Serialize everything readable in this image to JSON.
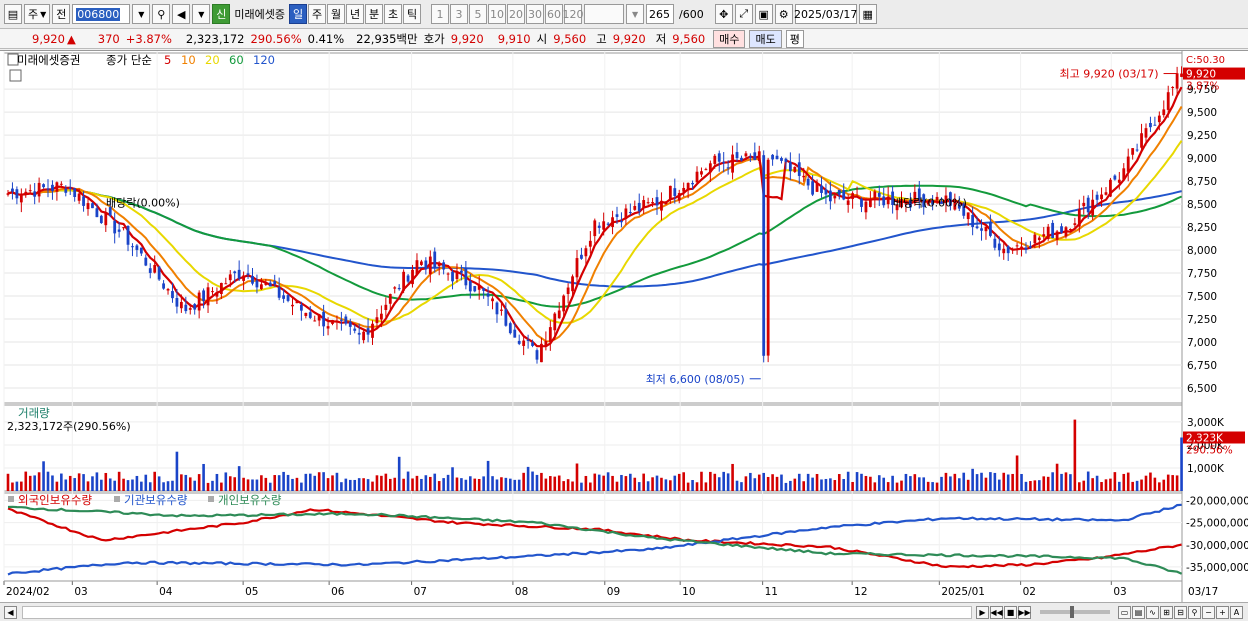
{
  "toolbar": {
    "period_main": "주",
    "prev": "전",
    "stock_code": "006800",
    "market_badge": "신",
    "stock_name": "미래에셋증",
    "periods": [
      "일",
      "주",
      "월",
      "년",
      "분",
      "초",
      "틱"
    ],
    "active_period": "일",
    "intervals": [
      "1",
      "3",
      "5",
      "10",
      "20",
      "30",
      "60",
      "120"
    ],
    "count": "265",
    "count_max": "/600",
    "date": "2025/03/17"
  },
  "quote": {
    "price": "9,920",
    "arrow": "▲",
    "change": "370",
    "change_pct": "+3.87%",
    "volume": "2,323,172",
    "volume_pct": "290.56%",
    "turnover": "0.41%",
    "amount": "22,935백만",
    "hoga_label": "호가",
    "ask": "9,920",
    "bid": "9,910",
    "open_label": "시",
    "open": "9,560",
    "high_label": "고",
    "high": "9,920",
    "low_label": "저",
    "low": "9,560",
    "buy": "매수",
    "sell": "매도",
    "avg": "평"
  },
  "price_panel": {
    "name": "미래에셋증권",
    "ma_label": "종가 단순",
    "ma_periods": [
      {
        "label": "5",
        "color": "#d40000"
      },
      {
        "label": "10",
        "color": "#f08000"
      },
      {
        "label": "20",
        "color": "#e8d800"
      },
      {
        "label": "60",
        "color": "#139a3c"
      },
      {
        "label": "120",
        "color": "#2255cc"
      }
    ],
    "corner_label": "C:50.30",
    "y_ticks": [
      "9,750",
      "9,500",
      "9,250",
      "9,000",
      "8,750",
      "8,500",
      "8,250",
      "8,000",
      "7,750",
      "7,500",
      "7,250",
      "7,000",
      "6,750",
      "6,500"
    ],
    "last_price_tag": "9,920",
    "last_pct_tag": "3.87%",
    "max_label": "최고 9,920 (03/17)",
    "min_label": "최저 6,600 (08/05)",
    "dividend_label_1": "배당락(0.00%)",
    "dividend_label_2": "배당락(0.00%)"
  },
  "volume_panel": {
    "title": "거래량",
    "value": "2,323,172주(290.56%)",
    "y_ticks": [
      "3,000K",
      "2,000K",
      "1,000K"
    ],
    "last_tag": "2,323K",
    "last_pct": "290.56%"
  },
  "holding_panel": {
    "series": [
      {
        "name": "외국인보유수량",
        "color": "#d40000"
      },
      {
        "name": "기관보유수량",
        "color": "#2255cc"
      },
      {
        "name": "개인보유수량",
        "color": "#2e8b57"
      }
    ],
    "y_ticks": [
      "-20,000,000",
      "-25,000,000",
      "-30,000,000",
      "-35,000,000"
    ]
  },
  "x_axis": {
    "labels": [
      "2024/02",
      "03",
      "04",
      "05",
      "06",
      "07",
      "08",
      "09",
      "10",
      "11",
      "12",
      "2025/01",
      "02",
      "03",
      "03/17"
    ]
  },
  "chart_data": {
    "type": "candlestick",
    "y_range": [
      6380,
      10100
    ],
    "min_point": {
      "date": "08/05",
      "value": 6600
    },
    "max_point": {
      "date": "03/17",
      "value": 9920
    },
    "close_profile": [
      {
        "label": "2024/02",
        "close": 8620
      },
      {
        "label": "03",
        "close": 8700
      },
      {
        "label": "04",
        "close": 8150
      },
      {
        "label": "05",
        "close": 7350
      },
      {
        "label": "05",
        "close": 7780
      },
      {
        "label": "06",
        "close": 7350
      },
      {
        "label": "07",
        "close": 7050
      },
      {
        "label": "07",
        "close": 7900
      },
      {
        "label": "08",
        "close": 7600
      },
      {
        "label": "08",
        "close": 6850
      },
      {
        "label": "09",
        "close": 8300
      },
      {
        "label": "10",
        "close": 8500
      },
      {
        "label": "10",
        "close": 8950
      },
      {
        "label": "11",
        "close": 9000
      },
      {
        "label": "11",
        "close": 8550
      },
      {
        "label": "12",
        "close": 8550
      },
      {
        "label": "12",
        "close": 8550
      },
      {
        "label": "2025/01",
        "close": 8000
      },
      {
        "label": "02",
        "close": 8250
      },
      {
        "label": "03",
        "close": 8850
      },
      {
        "label": "03/17",
        "close": 9920
      }
    ],
    "last_close": 9920,
    "last_volume": 2323172,
    "holding_end": {
      "외국인보유수량": -30000000,
      "기관보유수량": -21000000,
      "개인보유수량": -36500000
    }
  }
}
